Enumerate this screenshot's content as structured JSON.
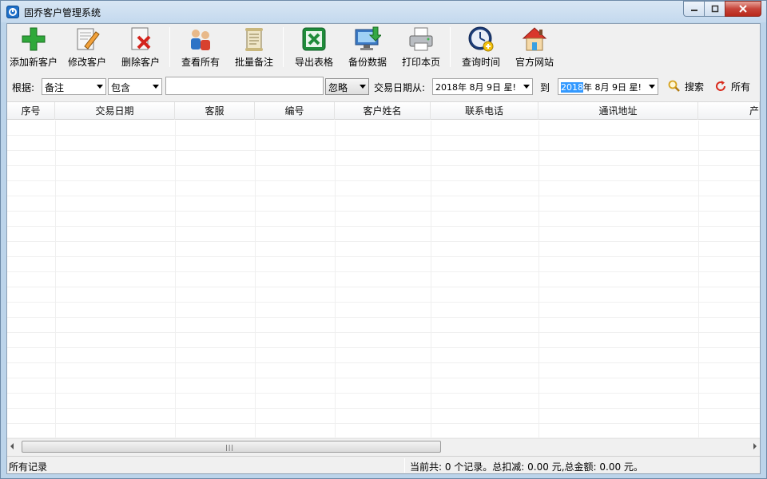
{
  "window": {
    "title": "固乔客户管理系统"
  },
  "toolbar": {
    "buttons": [
      {
        "label": "添加新客户",
        "icon": "add-icon"
      },
      {
        "label": "修改客户",
        "icon": "edit-icon"
      },
      {
        "label": "删除客户",
        "icon": "delete-icon"
      },
      {
        "label": "查看所有",
        "icon": "people-icon"
      },
      {
        "label": "批量备注",
        "icon": "scroll-icon"
      },
      {
        "label": "导出表格",
        "icon": "excel-icon"
      },
      {
        "label": "备份数据",
        "icon": "monitor-download-icon"
      },
      {
        "label": "打印本页",
        "icon": "printer-icon"
      },
      {
        "label": "查询时间",
        "icon": "clock-icon"
      },
      {
        "label": "官方网站",
        "icon": "house-icon"
      }
    ]
  },
  "filter": {
    "basis_label": "根据:",
    "field_value": "备注",
    "match_value": "包含",
    "keyword_value": "",
    "ignore_value": "忽略",
    "date_from_label": "交易日期从:",
    "date_from_value": "2018年 8月 9日 星!",
    "to_label": "到",
    "date_to_year": "2018",
    "date_to_rest": "年  8月  9日  星!",
    "search_label": "搜索",
    "all_label": "所有"
  },
  "grid": {
    "columns": [
      "序号",
      "交易日期",
      "客服",
      "编号",
      "客户姓名",
      "联系电话",
      "通讯地址",
      "产"
    ],
    "rows": []
  },
  "status": {
    "left": "所有记录",
    "right": "当前共: 0 个记录。总扣减: 0.00 元,总金额: 0.00 元。"
  },
  "colors": {
    "accent": "#3399ff",
    "titlebar": "#c4d9ee",
    "close": "#c7453a"
  }
}
